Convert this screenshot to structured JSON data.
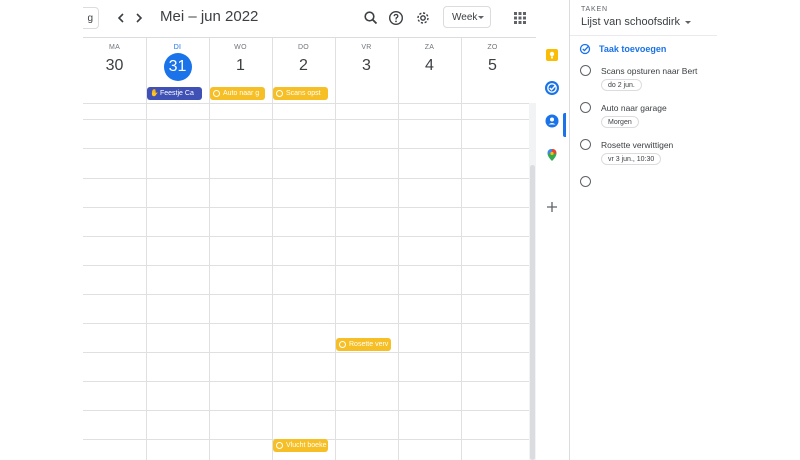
{
  "header": {
    "today_partial": "g",
    "month_title": "Mei – jun 2022",
    "view_select": "Week"
  },
  "days": [
    {
      "name": "MA",
      "num": "30",
      "today": false
    },
    {
      "name": "DI",
      "num": "31",
      "today": true
    },
    {
      "name": "WO",
      "num": "1",
      "today": false
    },
    {
      "name": "DO",
      "num": "2",
      "today": false
    },
    {
      "name": "VR",
      "num": "3",
      "today": false
    },
    {
      "name": "ZA",
      "num": "4",
      "today": false
    },
    {
      "name": "ZO",
      "num": "5",
      "today": false
    }
  ],
  "allday_events": [
    {
      "label": "Feestje Ca",
      "day": "DI",
      "color": "#3f51b5"
    },
    {
      "label": "Auto naar g",
      "day": "WO",
      "color": "#f6bf26"
    },
    {
      "label": "Scans opst",
      "day": "DO",
      "color": "#f6bf26"
    }
  ],
  "timed_events": [
    {
      "label": "Rosette verv",
      "day": "VR",
      "color": "#f6bf26"
    },
    {
      "label": "Vlucht boeke",
      "day": "DO",
      "color": "#f6bf26"
    }
  ],
  "side_rail": {
    "icons": [
      "keep-icon",
      "tasks-icon",
      "contacts-icon",
      "maps-icon",
      "add-icon"
    ],
    "active": "tasks-icon"
  },
  "tasks_panel": {
    "label": "TAKEN",
    "list_name": "Lijst van schoofsdirk",
    "add_label": "Taak toevoegen",
    "items": [
      {
        "title": "Scans opsturen naar Bert",
        "due": "do 2 jun."
      },
      {
        "title": "Auto naar garage",
        "due": "Morgen"
      },
      {
        "title": "Rosette verwittigen",
        "due": "vr 3 jun., 10:30"
      }
    ]
  },
  "colors": {
    "accent": "#1a73e8",
    "event_blue": "#3f51b5",
    "event_amber": "#f6bf26"
  }
}
